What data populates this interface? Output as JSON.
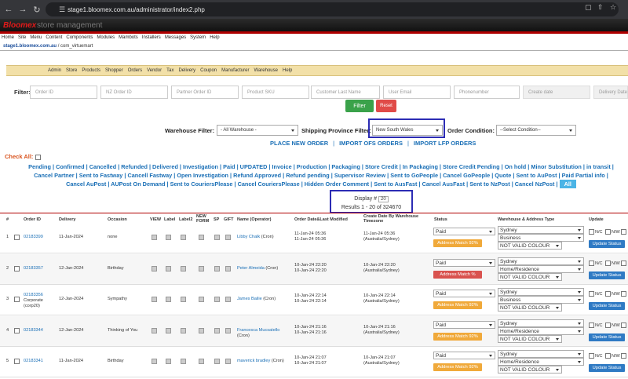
{
  "browser": {
    "url": "stage1.bloomex.com.au/administrator/index2.php"
  },
  "header": {
    "brand": "Bloomex",
    "subtitle": "store management"
  },
  "main_menu": [
    "Home",
    "Site",
    "Menu",
    "Content",
    "Components",
    "Modules",
    "Mambots",
    "Installers",
    "Messages",
    "System",
    "Help"
  ],
  "path": {
    "host": "stage1.bloomex.com.au",
    "component": "/ com_virtuemart"
  },
  "vm_menu": [
    "Admin",
    "Store",
    "Products",
    "Shopper",
    "Orders",
    "Vendor",
    "Tax",
    "Delivery",
    "Coupon",
    "Manufacturer",
    "Warehouse",
    "Help"
  ],
  "filter": {
    "label": "Filter:",
    "placeholders": [
      "Order ID",
      "NZ Order ID",
      "Partner Order ID",
      "Product SKU",
      "Customer Last Name",
      "User Email",
      "Phonenumber",
      "Create date",
      "Delivery Date"
    ],
    "filter_button": "Filter",
    "reset_button": "Reset",
    "warehouse_label": "Warehouse Filter:",
    "warehouse_value": "- All Warehouse -",
    "province_label": "Shipping Province Filter:",
    "province_value": "New South Wales",
    "condition_label": "Order Condition:",
    "condition_value": "--Select Condition--"
  },
  "action_links": [
    "PLACE NEW ORDER",
    "IMPORT OFS ORDERS",
    "IMPORT LFP ORDERS"
  ],
  "check_all_label": "Check All:",
  "status_links": [
    "Pending",
    "Confirmed",
    "Cancelled",
    "Refunded",
    "Delivered",
    "Investigation",
    "Paid",
    "UPDATED",
    "Invoice",
    "Production",
    "Packaging",
    "Store Credit",
    "In Packaging",
    "Store Credit Pending",
    "On hold",
    "Minor Substitution",
    "in transit",
    "Cancel Partner",
    "Sent to Fastway",
    "Cancell Fastway",
    "Open Investigation",
    "Refund Approved",
    "Refund pending",
    "Supervisor Review",
    "Sent to GoPeople",
    "Cancel GoPeople",
    "Quote",
    "Sent to AuPost",
    "Paid Partial info",
    "Cancel AuPost",
    "AUPost On Demand",
    "Sent to CouriersPlease",
    "Cancel CouriersPlease",
    "Hidden Order Comment",
    "Sent to AusFast",
    "Cancel AusFast",
    "Sent to NzPost",
    "Cancel NzPost"
  ],
  "all_label": "All",
  "display": {
    "label": "Display #",
    "value": "20",
    "results": "Results 1 - 20 of 324670"
  },
  "table_headers": {
    "num": "#",
    "order_id": "Order ID",
    "delivery": "Delivery",
    "occasion": "Occasion",
    "view": "VIEW",
    "label": "Label",
    "label2": "Label2",
    "new_form": "NEW FORM",
    "sp": "SP",
    "gift": "GIFT",
    "name": "Name (Operator)",
    "order_date": "Order Date&Last Modified",
    "create_date": "Create Date By Warehouse Timezone",
    "status": "Status",
    "warehouse": "Warehouse & Address Type",
    "update": "Update"
  },
  "rows": [
    {
      "num": "1",
      "order_id": "02183399",
      "extra": "",
      "delivery": "11-Jan-2024",
      "occasion": "none",
      "name": "Libby Chalk",
      "operator": "(Cron)",
      "order_date": "11-Jan-24 05:36",
      "modified": "11-Jan-24 05:36",
      "create_date": "11-Jan-24 05:36",
      "tz": "(Australia/Sydney)",
      "status": "Paid",
      "address_match": "Address Match 92%",
      "match_color": "orange",
      "warehouse": "Sydney",
      "address_type": "Business",
      "valid": "NOT VALID COLOUR"
    },
    {
      "num": "2",
      "order_id": "02183357",
      "extra": "",
      "delivery": "12-Jan-2024",
      "occasion": "Birthday",
      "name": "Peter Almeida",
      "operator": "(Cron)",
      "order_date": "10-Jan-24 22:20",
      "modified": "10-Jan-24 22:20",
      "create_date": "10-Jan-24 22:20",
      "tz": "(Australia/Sydney)",
      "status": "Paid",
      "address_match": "Address Match %",
      "match_color": "red",
      "warehouse": "Sydney",
      "address_type": "Home/Residence",
      "valid": "NOT VALID COLOUR"
    },
    {
      "num": "3",
      "order_id": "02183356",
      "extra": "Corporate (corp20)",
      "delivery": "12-Jan-2024",
      "occasion": "Sympathy",
      "name": "James Bailie",
      "operator": "(Cron)",
      "order_date": "10-Jan-24 22:14",
      "modified": "10-Jan-24 22:14",
      "create_date": "10-Jan-24 22:14",
      "tz": "(Australia/Sydney)",
      "status": "Paid",
      "address_match": "Address Match 92%",
      "match_color": "orange",
      "warehouse": "Sydney",
      "address_type": "Business",
      "valid": "NOT VALID COLOUR"
    },
    {
      "num": "4",
      "order_id": "02183344",
      "extra": "",
      "delivery": "12-Jan-2024",
      "occasion": "Thinking of You",
      "name": "Francesca Mucsatello",
      "operator": "(Cron)",
      "order_date": "10-Jan-24 21:16",
      "modified": "10-Jan-24 21:16",
      "create_date": "10-Jan-24 21:16",
      "tz": "(Australia/Sydney)",
      "status": "Paid",
      "address_match": "Address Match 92%",
      "match_color": "orange",
      "warehouse": "Sydney",
      "address_type": "Home/Residence",
      "valid": "NOT VALID COLOUR"
    },
    {
      "num": "5",
      "order_id": "02183341",
      "extra": "",
      "delivery": "11-Jan-2024",
      "occasion": "Birthday",
      "name": "maverick bradley",
      "operator": "(Cron)",
      "order_date": "10-Jan-24 21:07",
      "modified": "10-Jan-24 21:07",
      "create_date": "10-Jan-24 21:07",
      "tz": "(Australia/Sydney)",
      "status": "Paid",
      "address_match": "Address Match 92%",
      "match_color": "orange",
      "warehouse": "Sydney",
      "address_type": "Home/Residence",
      "valid": "NOT VALID COLOUR"
    }
  ],
  "row_labels": {
    "nc": "N/C",
    "nw": "N/W",
    "n": "N/",
    "update_button": "Update Status"
  }
}
